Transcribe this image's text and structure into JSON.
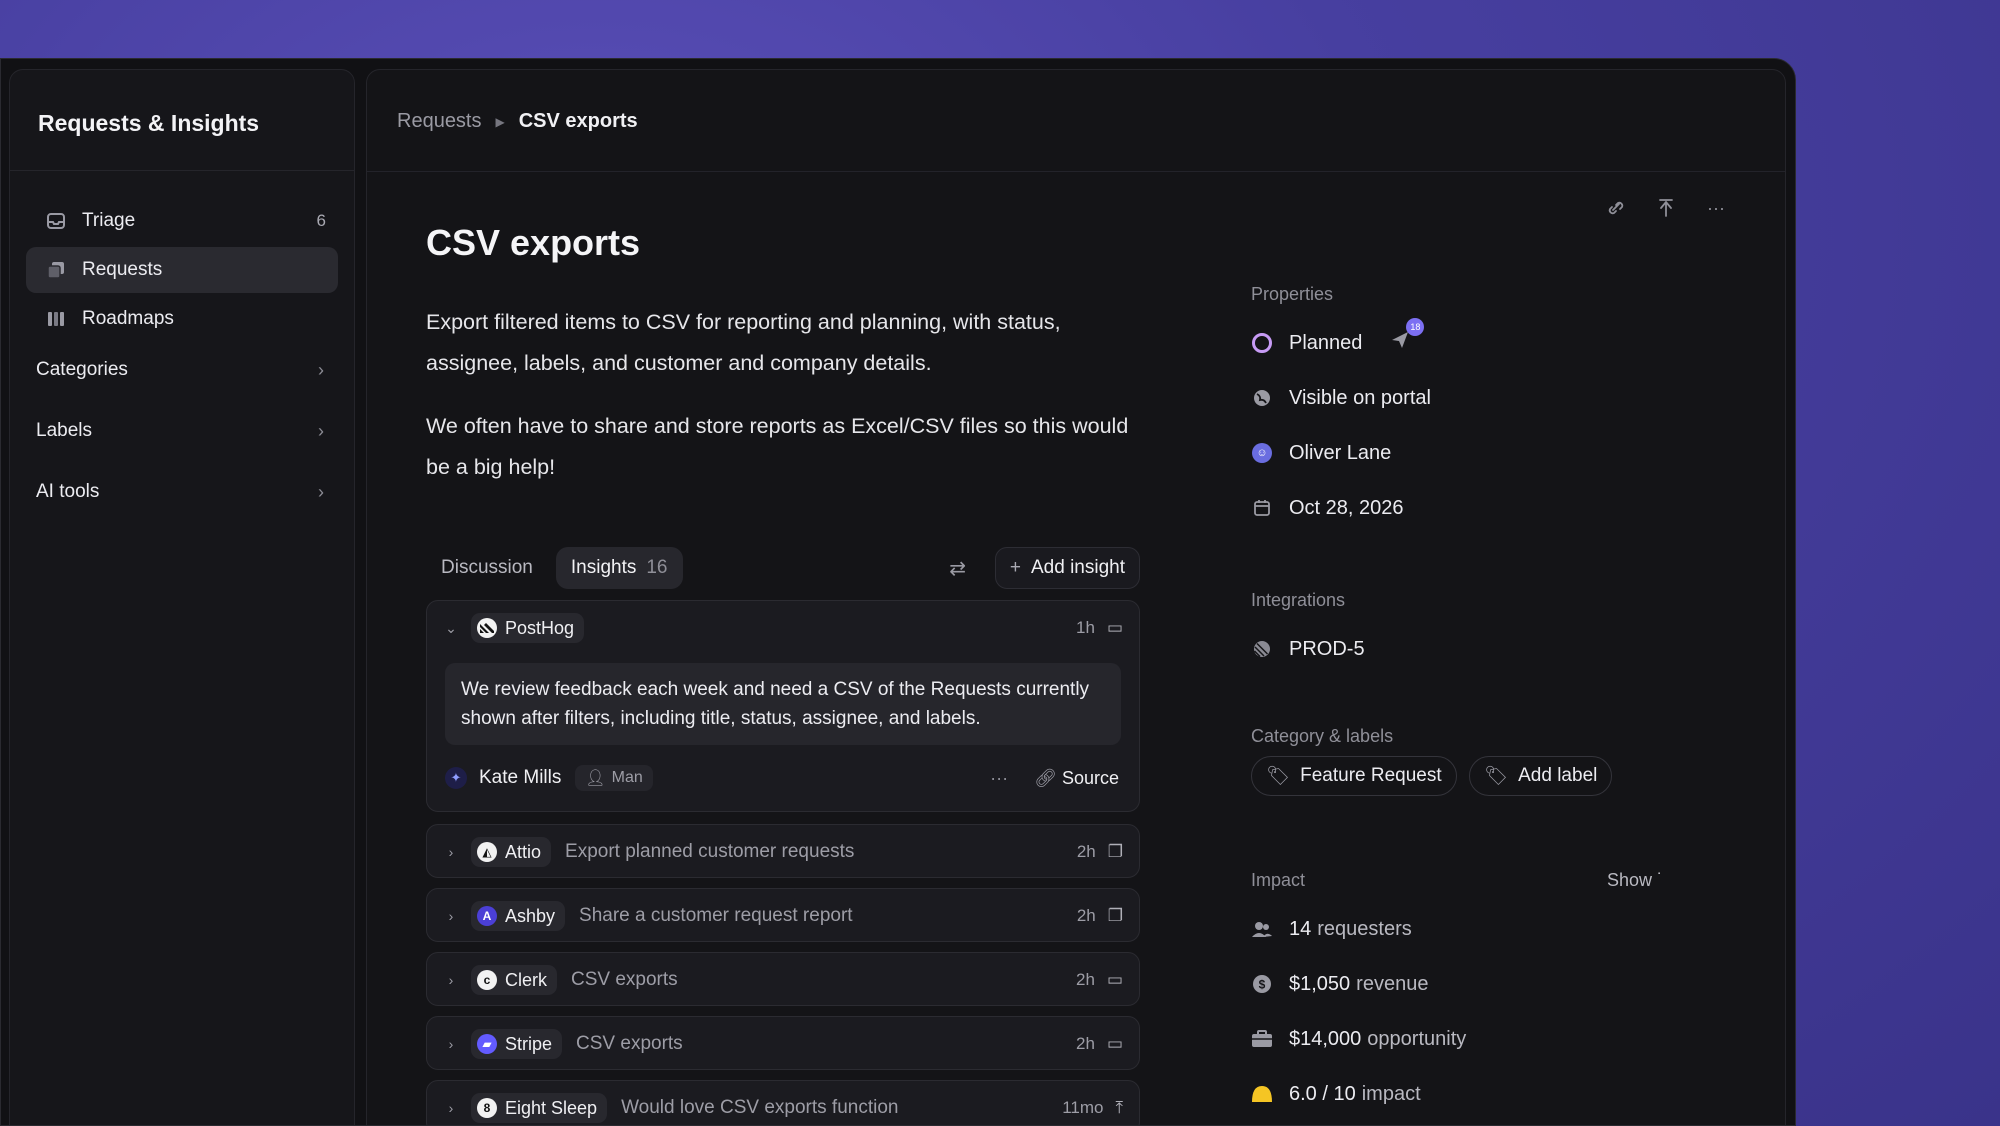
{
  "sidebar": {
    "title": "Requests & Insights",
    "nav": [
      {
        "label": "Triage",
        "count": "6",
        "icon": "inbox-icon"
      },
      {
        "label": "Requests",
        "icon": "stack-icon"
      },
      {
        "label": "Roadmaps",
        "icon": "map-icon"
      }
    ],
    "sections": [
      {
        "label": "Categories"
      },
      {
        "label": "Labels"
      },
      {
        "label": "AI tools"
      }
    ]
  },
  "breadcrumb": {
    "parent": "Requests",
    "current": "CSV exports"
  },
  "page": {
    "title": "CSV exports",
    "description": [
      "Export filtered items to CSV for reporting and planning, with status, assignee, labels, and customer and company details.",
      "We often have to share and store reports as Excel/CSV files so this would be a big help!"
    ]
  },
  "tabs": {
    "discussion": "Discussion",
    "insights": "Insights",
    "insights_count": "16",
    "add_insight": "Add insight"
  },
  "insights": {
    "expanded": {
      "company": "PostHog",
      "time": "1h",
      "quote": "We review feedback each week and need a CSV of the Requests currently shown after filters, including title, status, assignee, and labels.",
      "author": "Kate Mills",
      "author_tag": "Man",
      "source": "Source"
    },
    "rows": [
      {
        "company": "Attio",
        "text": "Export planned customer requests",
        "time": "2h",
        "logo_bg": "#f2f2f2",
        "logo_char": "◭"
      },
      {
        "company": "Ashby",
        "text": "Share a customer request report",
        "time": "2h",
        "logo_bg": "#4b3fd6",
        "logo_char": "A"
      },
      {
        "company": "Clerk",
        "text": "CSV exports",
        "time": "2h",
        "logo_bg": "#f2f2f2",
        "logo_char": "c"
      },
      {
        "company": "Stripe",
        "text": "CSV exports",
        "time": "2h",
        "logo_bg": "#635bff",
        "logo_char": "▰"
      },
      {
        "company": "Eight Sleep",
        "text": "Would love CSV exports function",
        "time": "11mo",
        "logo_bg": "#f2f2f2",
        "logo_char": "8"
      }
    ]
  },
  "properties": {
    "heading": "Properties",
    "status": "Planned",
    "status_badge": "18",
    "visibility": "Visible on portal",
    "assignee": "Oliver Lane",
    "date": "Oct 28, 2026"
  },
  "integrations": {
    "heading": "Integrations",
    "item": "PROD-5"
  },
  "category_labels": {
    "heading": "Category & labels",
    "category": "Feature Request",
    "add_label": "Add label"
  },
  "impact": {
    "heading": "Impact",
    "show": "Show ˙",
    "requesters_value": "14",
    "requesters_unit": "requesters",
    "revenue_value": "$1,050",
    "revenue_unit": "revenue",
    "opportunity_value": "$14,000",
    "opportunity_unit": "opportunity",
    "score_value": "6.0 / 10",
    "score_unit": "impact"
  },
  "colors": {
    "accent": "#7c6ff2",
    "status_ring": "#c79bf5",
    "impact_yellow": "#f5c524"
  }
}
